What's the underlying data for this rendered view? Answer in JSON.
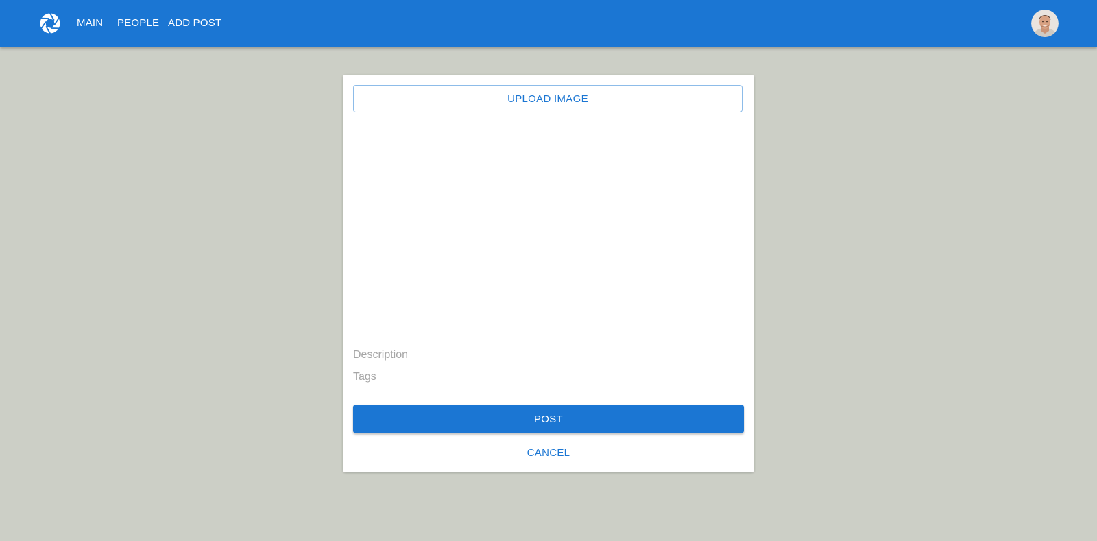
{
  "colors": {
    "primary": "#1b76d3",
    "background": "#cccfc6",
    "card": "#ffffff"
  },
  "header": {
    "logo_icon": "camera-aperture-icon",
    "nav": [
      {
        "label": "MAIN"
      },
      {
        "label": "PEOPLE"
      },
      {
        "label": "ADD POST"
      }
    ],
    "avatar_icon": "user-avatar"
  },
  "form": {
    "upload_label": "UPLOAD IMAGE",
    "description_placeholder": "Description",
    "description_value": "",
    "tags_placeholder": "Tags",
    "tags_value": "",
    "post_label": "POST",
    "cancel_label": "CANCEL"
  }
}
